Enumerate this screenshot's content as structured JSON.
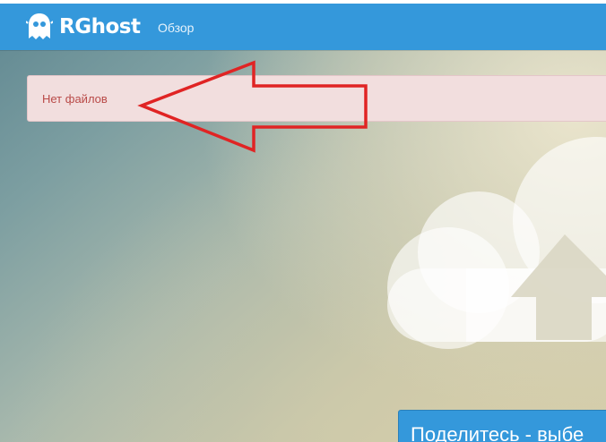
{
  "header": {
    "brand": "RGhost",
    "nav_overview": "Обзор",
    "accent_color": "#3498db",
    "logo_icon": "ghost-icon"
  },
  "alert": {
    "message": "Нет файлов",
    "bg_color": "#f2dede",
    "text_color": "#b94a48"
  },
  "annotation": {
    "icon": "red-arrow-icon",
    "color": "#e02424"
  },
  "hero": {
    "icon": "cloud-upload-icon"
  },
  "share_panel": {
    "title": "Поделитесь - выбе"
  }
}
